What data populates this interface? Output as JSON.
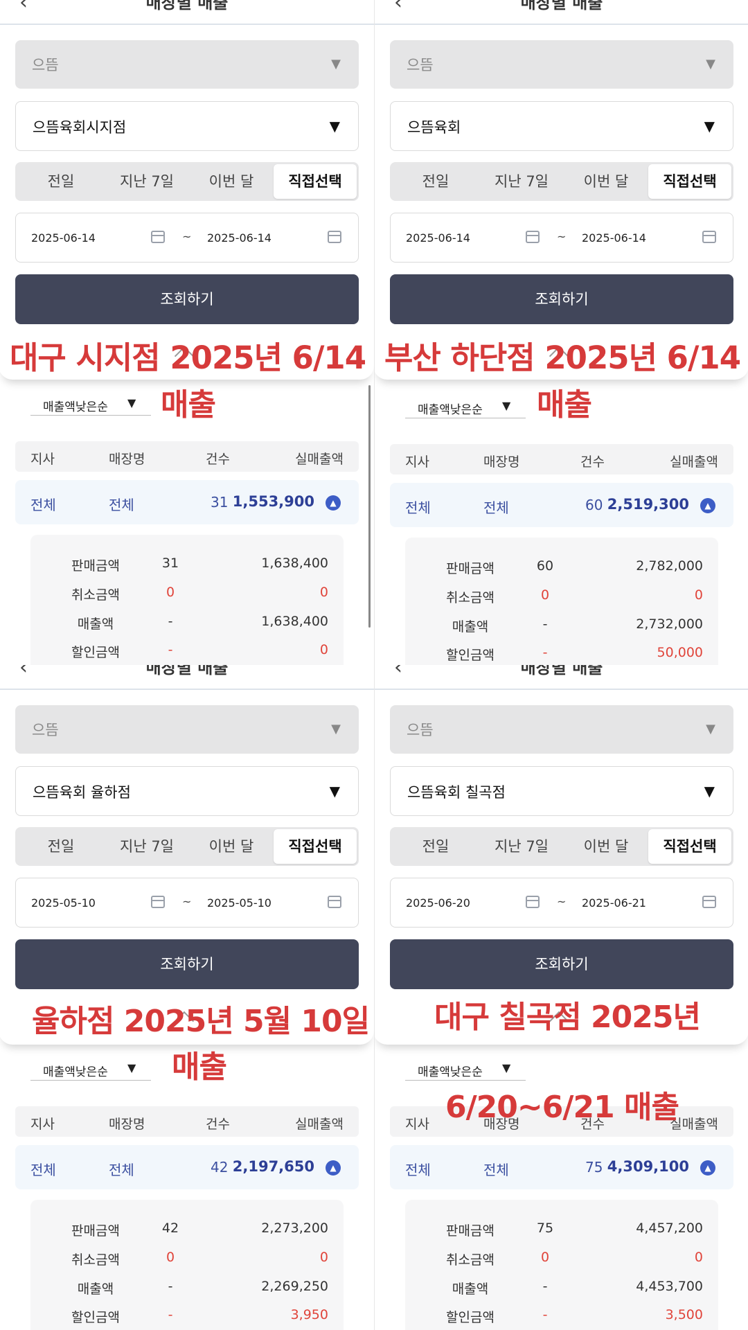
{
  "header_title": "매장별 매출",
  "brand_select": "으뜸",
  "period_tabs": [
    "전일",
    "지난 7일",
    "이번 달",
    "직접선택"
  ],
  "date_separator": "~",
  "search_button": "조회하기",
  "sort_label": "매출액낮은순",
  "table_headers": {
    "branch": "지사",
    "store": "매장명",
    "count": "건수",
    "net_sales": "실매출액"
  },
  "detail_labels": {
    "sales": "판매금액",
    "cancel": "취소금액",
    "revenue": "매출액",
    "discount": "할인금액"
  },
  "colors": {
    "button": "#41465a",
    "summary_text": "#2d3f96",
    "annotation": "#d63a3a",
    "negative": "#e0443a"
  },
  "panels": [
    {
      "store_select": "으뜸육회시지점",
      "date_from": "2025-06-14",
      "date_to": "2025-06-14",
      "summary": {
        "branch": "전체",
        "store": "전체",
        "count": "31",
        "net_sales": "1,553,900"
      },
      "details": {
        "sales_count": "31",
        "sales_amount": "1,638,400",
        "cancel_count": "0",
        "cancel_amount": "0",
        "revenue_count": "-",
        "revenue_amount": "1,638,400",
        "discount_count": "-",
        "discount_amount": "0"
      },
      "annotation_1": "대구 시지점 2025년 6/14",
      "annotation_2": "매출"
    },
    {
      "store_select": "으뜸육회",
      "date_from": "2025-06-14",
      "date_to": "2025-06-14",
      "summary": {
        "branch": "전체",
        "store": "전체",
        "count": "60",
        "net_sales": "2,519,300"
      },
      "details": {
        "sales_count": "60",
        "sales_amount": "2,782,000",
        "cancel_count": "0",
        "cancel_amount": "0",
        "revenue_count": "-",
        "revenue_amount": "2,732,000",
        "discount_count": "-",
        "discount_amount": "50,000"
      },
      "annotation_1": "부산 하단점 2025년 6/14",
      "annotation_2": "매출"
    },
    {
      "store_select": "으뜸육회 율하점",
      "date_from": "2025-05-10",
      "date_to": "2025-05-10",
      "summary": {
        "branch": "전체",
        "store": "전체",
        "count": "42",
        "net_sales": "2,197,650"
      },
      "details": {
        "sales_count": "42",
        "sales_amount": "2,273,200",
        "cancel_count": "0",
        "cancel_amount": "0",
        "revenue_count": "-",
        "revenue_amount": "2,269,250",
        "discount_count": "-",
        "discount_amount": "3,950"
      },
      "annotation_1": "율하점 2025년 5월 10일",
      "annotation_2": "매출"
    },
    {
      "store_select": "으뜸육회 칠곡점",
      "date_from": "2025-06-20",
      "date_to": "2025-06-21",
      "summary": {
        "branch": "전체",
        "store": "전체",
        "count": "75",
        "net_sales": "4,309,100"
      },
      "details": {
        "sales_count": "75",
        "sales_amount": "4,457,200",
        "cancel_count": "0",
        "cancel_amount": "0",
        "revenue_count": "-",
        "revenue_amount": "4,453,700",
        "discount_count": "-",
        "discount_amount": "3,500"
      },
      "annotation_1": "대구 칠곡점 2025년",
      "annotation_2": "6/20~6/21 매출"
    }
  ]
}
